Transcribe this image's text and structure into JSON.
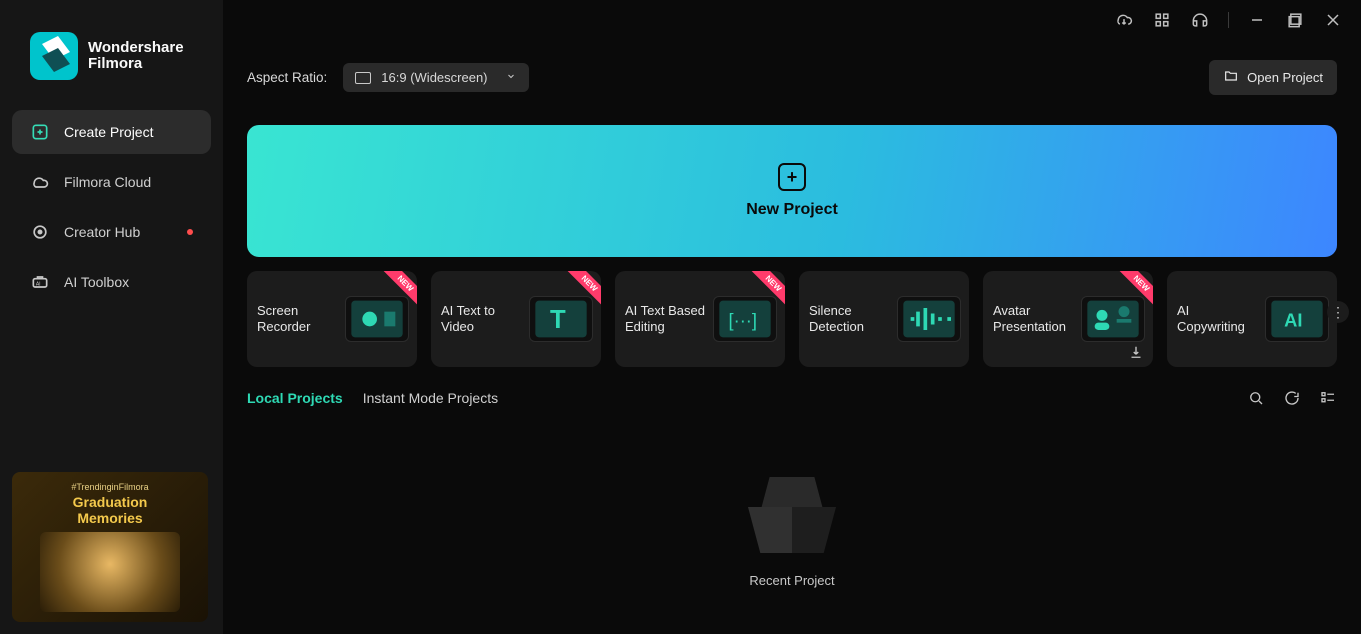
{
  "app": {
    "brand_line1": "Wondershare",
    "brand_line2": "Filmora"
  },
  "sidebar": {
    "items": [
      {
        "label": "Create Project"
      },
      {
        "label": "Filmora Cloud"
      },
      {
        "label": "Creator Hub"
      },
      {
        "label": "AI Toolbox"
      }
    ]
  },
  "promo": {
    "tag": "#TrendinginFilmora",
    "title_line1": "Graduation",
    "title_line2": "Memories"
  },
  "top": {
    "aspect_label": "Aspect Ratio:",
    "aspect_value": "16:9 (Widescreen)",
    "open_label": "Open Project"
  },
  "newproj": {
    "label": "New Project"
  },
  "tools": {
    "ribbon": "NEW",
    "items": [
      {
        "name": "Screen Recorder",
        "new": true
      },
      {
        "name": "AI Text to Video",
        "new": true
      },
      {
        "name": "AI Text Based Editing",
        "new": true
      },
      {
        "name": "Silence Detection",
        "new": false
      },
      {
        "name": "Avatar Presentation",
        "new": true,
        "download": true
      },
      {
        "name": "AI Copywriting",
        "new": false
      }
    ]
  },
  "tabs": {
    "local": "Local Projects",
    "instant": "Instant Mode Projects"
  },
  "empty": {
    "label": "Recent Project"
  }
}
